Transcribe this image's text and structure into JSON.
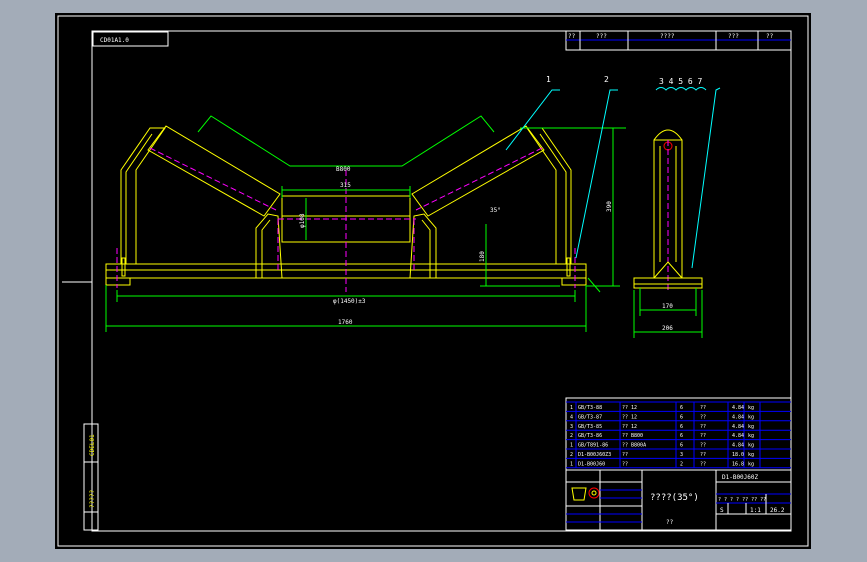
{
  "colors": {
    "background": "#a3acb8",
    "canvas": "#000000",
    "frame": "#ffffff",
    "part_outline": "#ffff00",
    "dimension": "#00ff00",
    "centerline": "#ff00ff",
    "leader": "#00ffff",
    "table_grid": "#0000ff",
    "note_red": "#ff0000"
  },
  "drawing": {
    "drawing_code": "CD01A1.0",
    "side_code": "CDEL01"
  },
  "header_table": {
    "cells": [
      "??",
      "???",
      "????",
      "???",
      "??"
    ]
  },
  "callouts": {
    "front_labels": [
      "1",
      "2"
    ],
    "side_label": "3 4 5 6 7"
  },
  "dimensions": {
    "overall_span": "1760",
    "hole_span": "φ(1450)±3",
    "inner_width": "B800",
    "middle_roll": "315",
    "roll_dia": "φ108",
    "height": "390",
    "side_base": "170",
    "side_overall": "206",
    "lower_height": "180",
    "angle": "35°"
  },
  "parts_list": {
    "rows": [
      {
        "no": "1",
        "name": "GB/T3-88",
        "spec": "?? 12",
        "qty": "6",
        "mat": "??",
        "wt": "4.84",
        "unit": "kg"
      },
      {
        "no": "4",
        "name": "GB/T3-87",
        "spec": "?? 12",
        "qty": "6",
        "mat": "??",
        "wt": "4.84",
        "unit": "kg"
      },
      {
        "no": "3",
        "name": "GB/T3-85",
        "spec": "?? 12",
        "qty": "6",
        "mat": "??",
        "wt": "4.84",
        "unit": "kg"
      },
      {
        "no": "2",
        "name": "GB/T3-86",
        "spec": "?? B800",
        "qty": "6",
        "mat": "??",
        "wt": "4.84",
        "unit": "kg"
      },
      {
        "no": "1",
        "name": "GB/T891-86",
        "spec": "?? B800A",
        "qty": "6",
        "mat": "??",
        "wt": "4.84",
        "unit": "kg"
      },
      {
        "no": "2",
        "name": "D1-B00J60Z3",
        "spec": "??",
        "qty": "3",
        "mat": "??",
        "wt": "18.0",
        "unit": "kg"
      },
      {
        "no": "1",
        "name": "D1-B00J60",
        "spec": "??",
        "qty": "2",
        "mat": "??",
        "wt": "16.8",
        "unit": "kg"
      }
    ]
  },
  "title_block": {
    "title": "????(35°)",
    "code": "D1-B00J60Z",
    "scale_row": "? ? ? ?  ?? ?? ??",
    "sheet": "S",
    "sheet_count": "1",
    "scale": "1:1",
    "total": "26.2",
    "company": "??",
    "left_notes": "?????"
  }
}
